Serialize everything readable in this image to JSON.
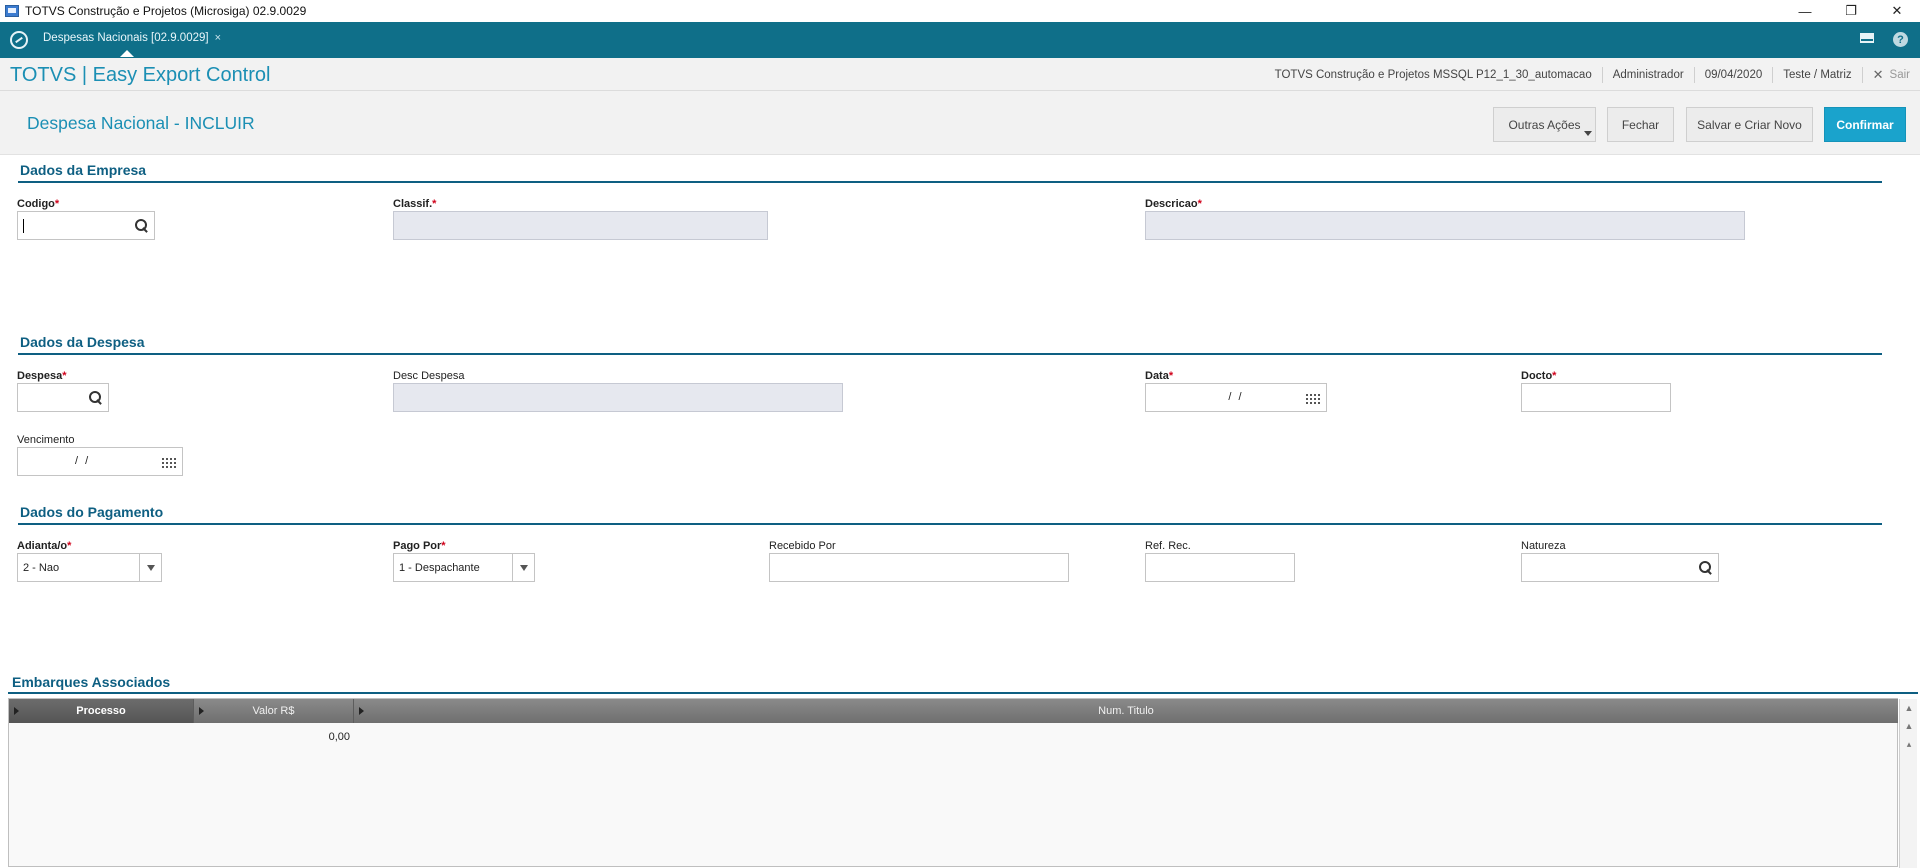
{
  "window": {
    "title": "TOTVS Construção e Projetos (Microsiga) 02.9.0029",
    "controls": {
      "minimize": "—",
      "maximize": "❐",
      "close": "✕"
    }
  },
  "tabbar": {
    "tab_label": "Despesas Nacionais [02.9.0029]",
    "tab_close": "×",
    "help": "?"
  },
  "appheader": {
    "title": "TOTVS | Easy Export Control",
    "company": "TOTVS Construção e Projetos MSSQL P12_1_30_automacao",
    "user": "Administrador",
    "date": "09/04/2020",
    "branch": "Teste / Matriz",
    "logout": "Sair"
  },
  "page": {
    "title": "Despesa Nacional - INCLUIR",
    "buttons": {
      "outras": "Outras Ações",
      "fechar": "Fechar",
      "salvar_novo": "Salvar e Criar Novo",
      "confirmar": "Confirmar"
    }
  },
  "empresa": {
    "section": "Dados da Empresa",
    "codigo_label": "Codigo",
    "codigo_value": "",
    "classif_label": "Classif.",
    "descricao_label": "Descricao"
  },
  "despesa": {
    "section": "Dados da Despesa",
    "despesa_label": "Despesa",
    "desc_label": "Desc Despesa",
    "data_label": "Data",
    "data_value": "/ /",
    "docto_label": "Docto",
    "vencimento_label": "Vencimento",
    "vencimento_value": "/ /"
  },
  "pagamento": {
    "section": "Dados do Pagamento",
    "adianta_label": "Adianta/o",
    "adianta_value": "2 - Nao",
    "pago_label": "Pago Por",
    "pago_value": "1 - Despachante",
    "recebido_label": "Recebido Por",
    "ref_label": "Ref. Rec.",
    "natureza_label": "Natureza"
  },
  "embarques": {
    "title": "Embarques Associados",
    "columns": [
      "Processo",
      "Valor R$",
      "Num. Titulo"
    ],
    "rows": [
      {
        "processo": "",
        "valor": "0,00",
        "num_titulo": ""
      }
    ]
  },
  "required_mark": "*"
}
